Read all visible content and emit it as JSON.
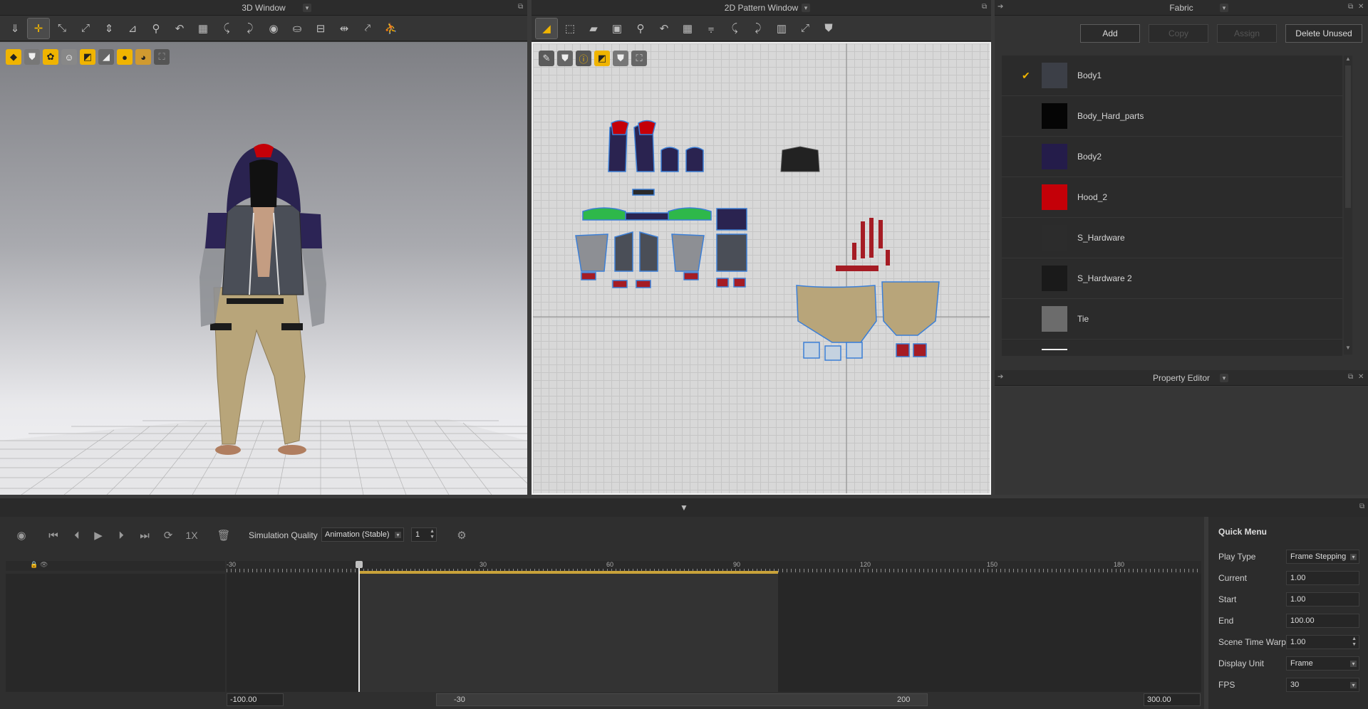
{
  "windows": {
    "view3d_title": "3D Window",
    "pattern2d_title": "2D Pattern Window",
    "fabric_title": "Fabric",
    "property_title": "Property Editor"
  },
  "fabric": {
    "buttons": {
      "add": "Add",
      "copy": "Copy",
      "assign": "Assign",
      "delete_unused": "Delete Unused"
    },
    "items": [
      {
        "name": "Body1",
        "color": "#3c3f47",
        "checked": true
      },
      {
        "name": "Body_Hard_parts",
        "color": "#050505",
        "checked": false
      },
      {
        "name": "Body2",
        "color": "#241c4a",
        "checked": false
      },
      {
        "name": "Hood_2",
        "color": "#c40008",
        "checked": false
      },
      {
        "name": "S_Hardware",
        "color": "#2c2c2c",
        "checked": false
      },
      {
        "name": "S_Hardware 2",
        "color": "#1a1a1a",
        "checked": false
      },
      {
        "name": "Tie",
        "color": "#6c6c6c",
        "checked": false
      }
    ]
  },
  "timeline": {
    "speed": "1X",
    "sim_quality_label": "Simulation Quality",
    "sim_quality_value": "Animation (Stable)",
    "sim_steps": "1",
    "ruler": [
      "-30",
      "30",
      "60",
      "90",
      "120",
      "150",
      "180"
    ],
    "range_start": "-100.00",
    "range_end": "300.00",
    "scroll_left": "-30",
    "scroll_right": "200"
  },
  "quick_menu": {
    "title": "Quick Menu",
    "rows": [
      {
        "label": "Play Type",
        "value": "Frame Stepping",
        "dropdown": true
      },
      {
        "label": "Current",
        "value": "1.00"
      },
      {
        "label": "Start",
        "value": "1.00"
      },
      {
        "label": "End",
        "value": "100.00"
      },
      {
        "label": "Scene Time Warp",
        "value": "1.00",
        "spinner": true
      },
      {
        "label": "Display Unit",
        "value": "Frame",
        "dropdown": true
      },
      {
        "label": "FPS",
        "value": "30",
        "dropdown": true
      }
    ]
  },
  "icons": {
    "toolbar3d": [
      "select-icon",
      "move-icon",
      "edit-pattern-icon",
      "segment-icon",
      "fold-icon",
      "tack-icon",
      "pin-icon",
      "arrange-icon",
      "grid-icon",
      "sewing-icon",
      "puckering-icon",
      "button-icon",
      "topstitch-icon",
      "measure-icon",
      "ruler-icon",
      "avatar-icon",
      "walk-icon"
    ],
    "toolbar2d": [
      "edit-point-icon",
      "transform-icon",
      "polygon-icon",
      "rectangle-icon",
      "internal-line-icon",
      "dart-icon",
      "grid-pattern-icon",
      "fold-line-icon",
      "segment-sew-icon",
      "free-sew-icon",
      "stripe-icon",
      "symmetric-icon",
      "garment-icon"
    ]
  }
}
